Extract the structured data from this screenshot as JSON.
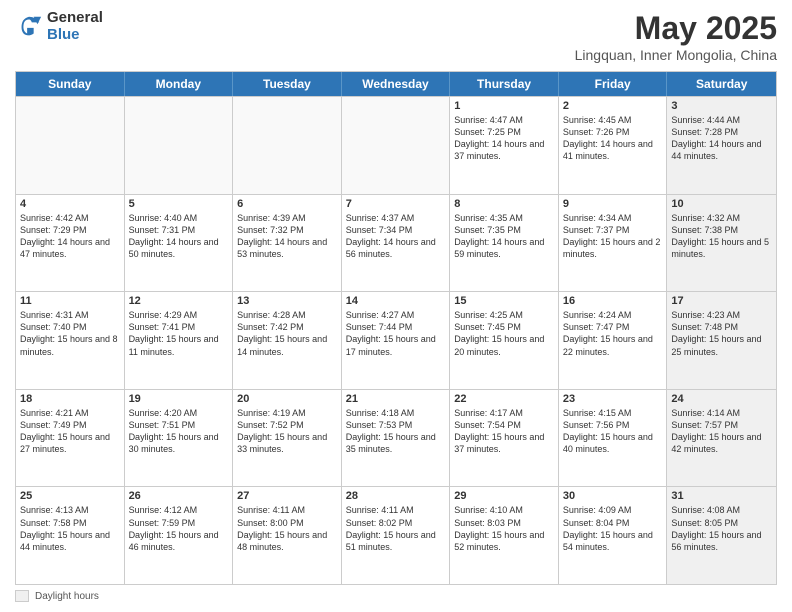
{
  "header": {
    "logo_general": "General",
    "logo_blue": "Blue",
    "month_title": "May 2025",
    "location": "Lingquan, Inner Mongolia, China"
  },
  "days_of_week": [
    "Sunday",
    "Monday",
    "Tuesday",
    "Wednesday",
    "Thursday",
    "Friday",
    "Saturday"
  ],
  "footer": {
    "label": "Daylight hours"
  },
  "weeks": [
    [
      {
        "day": "",
        "empty": true
      },
      {
        "day": "",
        "empty": true
      },
      {
        "day": "",
        "empty": true
      },
      {
        "day": "",
        "empty": true
      },
      {
        "day": "1",
        "sunrise": "Sunrise: 4:47 AM",
        "sunset": "Sunset: 7:25 PM",
        "daylight": "Daylight: 14 hours and 37 minutes."
      },
      {
        "day": "2",
        "sunrise": "Sunrise: 4:45 AM",
        "sunset": "Sunset: 7:26 PM",
        "daylight": "Daylight: 14 hours and 41 minutes."
      },
      {
        "day": "3",
        "sunrise": "Sunrise: 4:44 AM",
        "sunset": "Sunset: 7:28 PM",
        "daylight": "Daylight: 14 hours and 44 minutes.",
        "shaded": true
      }
    ],
    [
      {
        "day": "4",
        "sunrise": "Sunrise: 4:42 AM",
        "sunset": "Sunset: 7:29 PM",
        "daylight": "Daylight: 14 hours and 47 minutes."
      },
      {
        "day": "5",
        "sunrise": "Sunrise: 4:40 AM",
        "sunset": "Sunset: 7:31 PM",
        "daylight": "Daylight: 14 hours and 50 minutes."
      },
      {
        "day": "6",
        "sunrise": "Sunrise: 4:39 AM",
        "sunset": "Sunset: 7:32 PM",
        "daylight": "Daylight: 14 hours and 53 minutes."
      },
      {
        "day": "7",
        "sunrise": "Sunrise: 4:37 AM",
        "sunset": "Sunset: 7:34 PM",
        "daylight": "Daylight: 14 hours and 56 minutes."
      },
      {
        "day": "8",
        "sunrise": "Sunrise: 4:35 AM",
        "sunset": "Sunset: 7:35 PM",
        "daylight": "Daylight: 14 hours and 59 minutes."
      },
      {
        "day": "9",
        "sunrise": "Sunrise: 4:34 AM",
        "sunset": "Sunset: 7:37 PM",
        "daylight": "Daylight: 15 hours and 2 minutes."
      },
      {
        "day": "10",
        "sunrise": "Sunrise: 4:32 AM",
        "sunset": "Sunset: 7:38 PM",
        "daylight": "Daylight: 15 hours and 5 minutes.",
        "shaded": true
      }
    ],
    [
      {
        "day": "11",
        "sunrise": "Sunrise: 4:31 AM",
        "sunset": "Sunset: 7:40 PM",
        "daylight": "Daylight: 15 hours and 8 minutes."
      },
      {
        "day": "12",
        "sunrise": "Sunrise: 4:29 AM",
        "sunset": "Sunset: 7:41 PM",
        "daylight": "Daylight: 15 hours and 11 minutes."
      },
      {
        "day": "13",
        "sunrise": "Sunrise: 4:28 AM",
        "sunset": "Sunset: 7:42 PM",
        "daylight": "Daylight: 15 hours and 14 minutes."
      },
      {
        "day": "14",
        "sunrise": "Sunrise: 4:27 AM",
        "sunset": "Sunset: 7:44 PM",
        "daylight": "Daylight: 15 hours and 17 minutes."
      },
      {
        "day": "15",
        "sunrise": "Sunrise: 4:25 AM",
        "sunset": "Sunset: 7:45 PM",
        "daylight": "Daylight: 15 hours and 20 minutes."
      },
      {
        "day": "16",
        "sunrise": "Sunrise: 4:24 AM",
        "sunset": "Sunset: 7:47 PM",
        "daylight": "Daylight: 15 hours and 22 minutes."
      },
      {
        "day": "17",
        "sunrise": "Sunrise: 4:23 AM",
        "sunset": "Sunset: 7:48 PM",
        "daylight": "Daylight: 15 hours and 25 minutes.",
        "shaded": true
      }
    ],
    [
      {
        "day": "18",
        "sunrise": "Sunrise: 4:21 AM",
        "sunset": "Sunset: 7:49 PM",
        "daylight": "Daylight: 15 hours and 27 minutes."
      },
      {
        "day": "19",
        "sunrise": "Sunrise: 4:20 AM",
        "sunset": "Sunset: 7:51 PM",
        "daylight": "Daylight: 15 hours and 30 minutes."
      },
      {
        "day": "20",
        "sunrise": "Sunrise: 4:19 AM",
        "sunset": "Sunset: 7:52 PM",
        "daylight": "Daylight: 15 hours and 33 minutes."
      },
      {
        "day": "21",
        "sunrise": "Sunrise: 4:18 AM",
        "sunset": "Sunset: 7:53 PM",
        "daylight": "Daylight: 15 hours and 35 minutes."
      },
      {
        "day": "22",
        "sunrise": "Sunrise: 4:17 AM",
        "sunset": "Sunset: 7:54 PM",
        "daylight": "Daylight: 15 hours and 37 minutes."
      },
      {
        "day": "23",
        "sunrise": "Sunrise: 4:15 AM",
        "sunset": "Sunset: 7:56 PM",
        "daylight": "Daylight: 15 hours and 40 minutes."
      },
      {
        "day": "24",
        "sunrise": "Sunrise: 4:14 AM",
        "sunset": "Sunset: 7:57 PM",
        "daylight": "Daylight: 15 hours and 42 minutes.",
        "shaded": true
      }
    ],
    [
      {
        "day": "25",
        "sunrise": "Sunrise: 4:13 AM",
        "sunset": "Sunset: 7:58 PM",
        "daylight": "Daylight: 15 hours and 44 minutes."
      },
      {
        "day": "26",
        "sunrise": "Sunrise: 4:12 AM",
        "sunset": "Sunset: 7:59 PM",
        "daylight": "Daylight: 15 hours and 46 minutes."
      },
      {
        "day": "27",
        "sunrise": "Sunrise: 4:11 AM",
        "sunset": "Sunset: 8:00 PM",
        "daylight": "Daylight: 15 hours and 48 minutes."
      },
      {
        "day": "28",
        "sunrise": "Sunrise: 4:11 AM",
        "sunset": "Sunset: 8:02 PM",
        "daylight": "Daylight: 15 hours and 51 minutes."
      },
      {
        "day": "29",
        "sunrise": "Sunrise: 4:10 AM",
        "sunset": "Sunset: 8:03 PM",
        "daylight": "Daylight: 15 hours and 52 minutes."
      },
      {
        "day": "30",
        "sunrise": "Sunrise: 4:09 AM",
        "sunset": "Sunset: 8:04 PM",
        "daylight": "Daylight: 15 hours and 54 minutes."
      },
      {
        "day": "31",
        "sunrise": "Sunrise: 4:08 AM",
        "sunset": "Sunset: 8:05 PM",
        "daylight": "Daylight: 15 hours and 56 minutes.",
        "shaded": true
      }
    ]
  ]
}
